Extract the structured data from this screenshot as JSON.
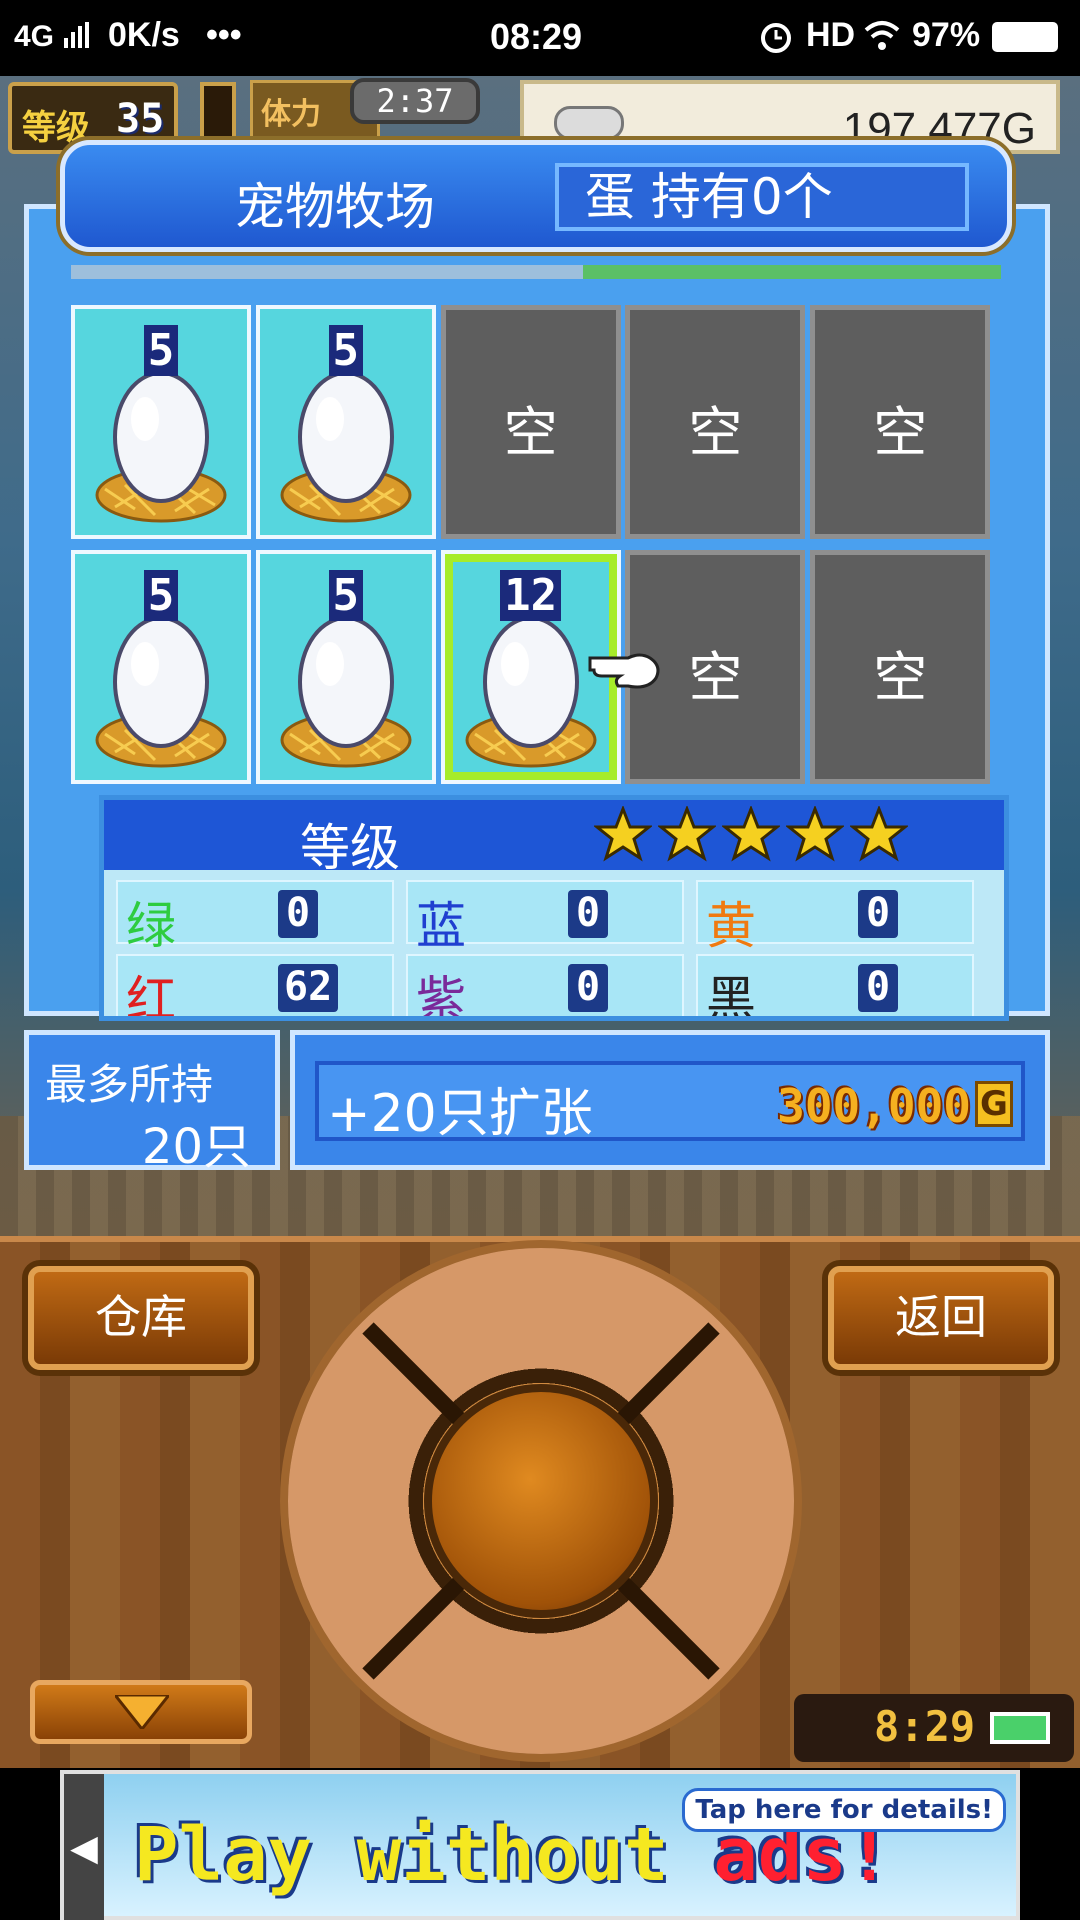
{
  "status_bar": {
    "network": "4G",
    "speed": "0K/s",
    "more": "•••",
    "time": "08:29",
    "hd": "HD",
    "battery": "97%"
  },
  "hud": {
    "level_label": "等级",
    "level": "35",
    "stamina_label": "体力",
    "timer": "2:37",
    "money": "197,477G"
  },
  "ranch": {
    "title": "宠物牧场",
    "egg_count": "蛋 持有0个",
    "progress_fraction": 0.45
  },
  "slots": [
    {
      "state": "egg",
      "level": "5"
    },
    {
      "state": "egg",
      "level": "5"
    },
    {
      "state": "empty",
      "label": "空"
    },
    {
      "state": "empty",
      "label": "空"
    },
    {
      "state": "empty",
      "label": "空"
    },
    {
      "state": "egg",
      "level": "5"
    },
    {
      "state": "egg",
      "level": "5"
    },
    {
      "state": "egg-selected",
      "level": "12"
    },
    {
      "state": "empty",
      "label": "空"
    },
    {
      "state": "empty",
      "label": "空"
    }
  ],
  "stats": {
    "grade_label": "等级",
    "stars": 5,
    "cells": [
      {
        "name": "绿",
        "value": "0",
        "color": "#2ecc40"
      },
      {
        "name": "蓝",
        "value": "0",
        "color": "#1f3fd0"
      },
      {
        "name": "黄",
        "value": "0",
        "color": "#f07a10"
      },
      {
        "name": "红",
        "value": "62",
        "color": "#e02020"
      },
      {
        "name": "紫",
        "value": "0",
        "color": "#7a2a9a"
      },
      {
        "name": "黑",
        "value": "0",
        "color": "#222222"
      }
    ]
  },
  "capacity": {
    "label": "最多所持",
    "value": "20只"
  },
  "expand": {
    "label": "+20只扩张",
    "price": "300,000",
    "currency": "G"
  },
  "controls": {
    "warehouse": "仓库",
    "back": "返回"
  },
  "clock": "8:29",
  "ad": {
    "text_main": "Play without ",
    "text_red": "ads!",
    "tap": "Tap here for details!"
  }
}
